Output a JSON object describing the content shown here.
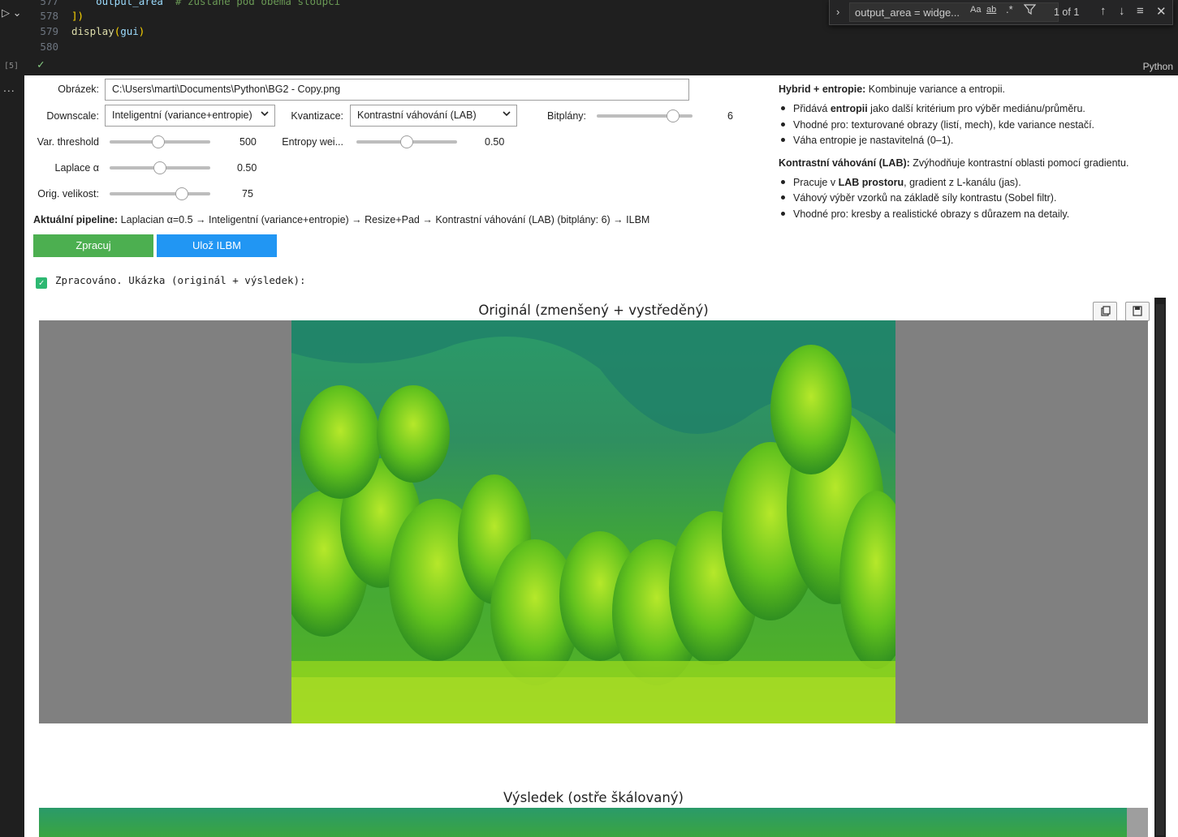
{
  "gutter": {
    "run_glyph": "▷ ⌄",
    "exec_count": "[5]",
    "more": "..."
  },
  "editor": {
    "lines": [
      {
        "num": "577",
        "code_var": "output_area",
        "code_comment": "  # zůstane pod oběma sloupci"
      },
      {
        "num": "578",
        "code_paren": "])"
      },
      {
        "num": "579",
        "code_fn": "display",
        "code_open": "(",
        "code_arg": "gui",
        "code_close": ")"
      },
      {
        "num": "580"
      }
    ],
    "status_icon": "check-icon",
    "language": "Python"
  },
  "find": {
    "query": "output_area = widge...",
    "opt_case": "Aa",
    "opt_word": "ab",
    "opt_regex": ".*",
    "matches": "1 of 1"
  },
  "form": {
    "image_label": "Obrázek:",
    "image_path": "C:\\Users\\marti\\Documents\\Python\\BG2 - Copy.png",
    "downscale_label": "Downscale:",
    "downscale_value": "Inteligentní (variance+entropie)",
    "quant_label": "Kvantizace:",
    "quant_value": "Kontrastní váhování (LAB)",
    "bitplanes_label": "Bitplány:",
    "bitplanes_value": "6",
    "bitplanes_level": 0.8,
    "var_label": "Var. threshold",
    "var_value": "500",
    "var_level": 0.48,
    "entropy_label": "Entropy wei...",
    "entropy_value": "0.50",
    "entropy_level": 0.5,
    "laplace_label": "Laplace α",
    "laplace_value": "0.50",
    "laplace_level": 0.5,
    "orig_label": "Orig. velikost:",
    "orig_value": "75",
    "orig_level": 0.72,
    "pipeline_label": "Aktuální pipeline:",
    "pipeline_value": "Laplacian α=0.5 → Inteligentní (variance+entropie) → Resize+Pad → Kontrastní váhování (LAB) (bitplány: 6) → ILBM",
    "process_button": "Zpracuj",
    "save_button": "Ulož ILBM",
    "process_color": "#4caf50",
    "save_color": "#2196f3"
  },
  "help": {
    "hybrid_title": "Hybrid + entropie:",
    "hybrid_desc": "Kombinuje variance a entropii.",
    "hybrid_b1_pre": "Přidává ",
    "hybrid_b1_bold": "entropii",
    "hybrid_b1_post": " jako další kritérium pro výběr mediánu/průměru.",
    "hybrid_b2": "Vhodné pro: texturované obrazy (listí, mech), kde variance nestačí.",
    "hybrid_b3": "Váha entropie je nastavitelná (0–1).",
    "lab_title": "Kontrastní váhování (LAB):",
    "lab_desc": "Zvýhodňuje kontrastní oblasti pomocí gradientu.",
    "lab_b1_pre": "Pracuje v ",
    "lab_b1_bold": "LAB prostoru",
    "lab_b1_post": ", gradient z L-kanálu (jas).",
    "lab_b2": "Váhový výběr vzorků na základě síly kontrastu (Sobel filtr).",
    "lab_b3": "Vhodné pro: kresby a realistické obrazy s důrazem na detaily."
  },
  "status": {
    "text": "Zpracováno. Ukázka (originál + výsledek):"
  },
  "figures": {
    "original_title": "Originál (zmenšený + vystředěný)",
    "result_title": "Výsledek (ostře škálovaný)",
    "copy_icon": "copy-icon",
    "save_icon": "save-icon"
  }
}
